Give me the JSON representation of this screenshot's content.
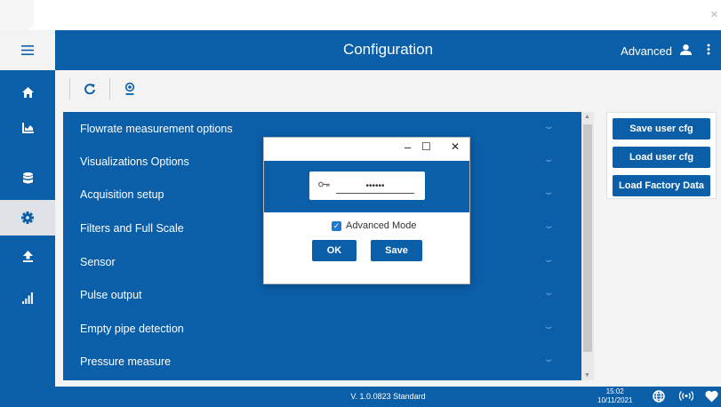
{
  "header": {
    "title": "Configuration",
    "mode": "Advanced"
  },
  "nav": {
    "items": [
      "home-icon",
      "chart-icon",
      "database-icon",
      "gear-icon",
      "upload-icon",
      "signal-bars-icon"
    ],
    "active": "gear-icon"
  },
  "toolbar": {
    "buttons": [
      "refresh-icon",
      "certificate-icon"
    ]
  },
  "accordion": {
    "items": [
      {
        "label": "Flowrate measurement options"
      },
      {
        "label": "Visualizations Options"
      },
      {
        "label": "Acquisition setup"
      },
      {
        "label": "Filters and Full Scale"
      },
      {
        "label": "Sensor"
      },
      {
        "label": "Pulse output"
      },
      {
        "label": "Empty pipe detection"
      },
      {
        "label": "Pressure measure"
      }
    ]
  },
  "actions": {
    "save_user_cfg": "Save user cfg",
    "load_user_cfg": "Load user cfg",
    "load_factory": "Load Factory Data"
  },
  "dialog": {
    "minimize": "–",
    "maximize": "☐",
    "close": "✕",
    "password_value": "••••••",
    "advanced_mode_label": "Advanced Mode",
    "advanced_mode_checked": true,
    "ok_label": "OK",
    "save_label": "Save"
  },
  "footer": {
    "version": "V. 1.0.0823  Standard",
    "time": "15:02",
    "date": "10/11/2021"
  },
  "colors": {
    "primary": "#0b5ea8",
    "checkbox": "#1f78d1"
  }
}
